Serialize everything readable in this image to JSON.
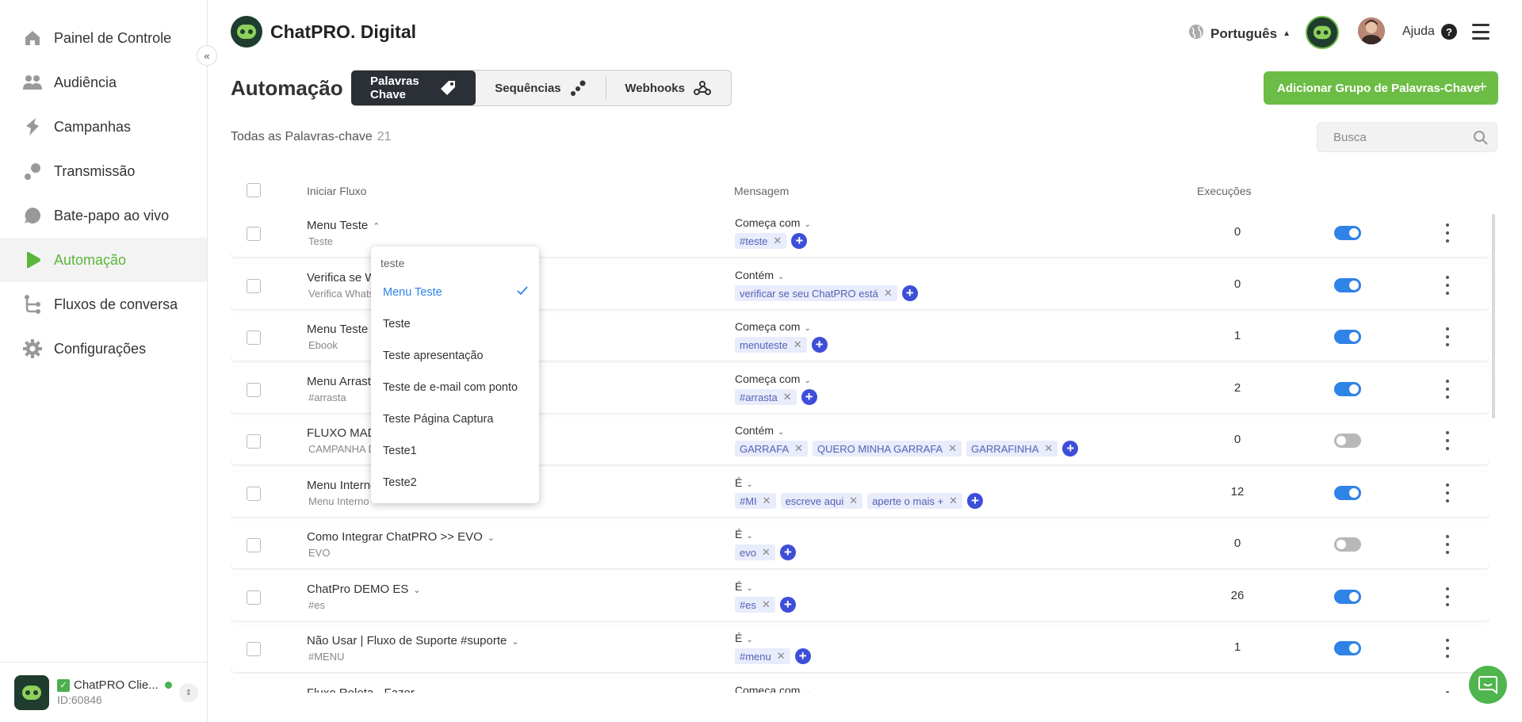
{
  "sidebar": {
    "items": [
      {
        "label": "Painel de Controle",
        "icon": "home-icon"
      },
      {
        "label": "Audiência",
        "icon": "people-icon"
      },
      {
        "label": "Campanhas",
        "icon": "lightning-icon"
      },
      {
        "label": "Transmissão",
        "icon": "broadcast-icon"
      },
      {
        "label": "Bate-papo ao vivo",
        "icon": "chat-bubble-icon"
      },
      {
        "label": "Automação",
        "icon": "play-icon",
        "active": true
      },
      {
        "label": "Fluxos de conversa",
        "icon": "flow-icon"
      },
      {
        "label": "Configurações",
        "icon": "gear-icon"
      }
    ],
    "collapse_icon": "«",
    "account": {
      "name": "ChatPRO Clie...",
      "id": "ID:60846"
    }
  },
  "header": {
    "brand": "ChatPRO. Digital",
    "language": "Português",
    "help": "Ajuda"
  },
  "page": {
    "title": "Automação",
    "tabs": [
      {
        "label": "Palavras Chave",
        "active": true
      },
      {
        "label": "Sequências"
      },
      {
        "label": "Webhooks"
      }
    ],
    "add_button": "Adicionar Grupo de Palavras-Chave",
    "counter_label": "Todas as Palavras-chave",
    "counter_value": "21",
    "search_placeholder": "Busca"
  },
  "table": {
    "headers": {
      "flow": "Iniciar Fluxo",
      "message": "Mensagem",
      "executions": "Execuções"
    },
    "rows": [
      {
        "name": "Menu Teste",
        "sub": "Teste",
        "chevron": "^",
        "condition": "Começa com",
        "tags": [
          "#teste"
        ],
        "executions": "0",
        "enabled": true
      },
      {
        "name": "Verifica se W",
        "sub": "Verifica Whats",
        "chevron": "",
        "condition": "Contém",
        "tags": [
          "verificar se seu ChatPRO está"
        ],
        "executions": "0",
        "enabled": true
      },
      {
        "name": "Menu Teste -",
        "sub": "Ebook",
        "chevron": "",
        "condition": "Começa com",
        "tags": [
          "menuteste"
        ],
        "executions": "1",
        "enabled": true
      },
      {
        "name": "Menu Arrast",
        "sub": "#arrasta",
        "chevron": "",
        "condition": "Começa com",
        "tags": [
          "#arrasta"
        ],
        "executions": "2",
        "enabled": true
      },
      {
        "name": "FLUXO MAD",
        "sub": "CAMPANHA D",
        "chevron": "",
        "condition": "Contém",
        "tags": [
          "GARRAFA",
          "QUERO MINHA GARRAFA",
          "GARRAFINHA"
        ],
        "executions": "0",
        "enabled": false
      },
      {
        "name": "Menu Interno",
        "sub": "Menu Interno",
        "chevron": "",
        "condition": "É",
        "tags": [
          "#MI",
          "escreve aqui",
          "aperte o mais +"
        ],
        "executions": "12",
        "enabled": true
      },
      {
        "name": "Como Integrar ChatPRO >> EVO",
        "sub": "EVO",
        "chevron": "v",
        "condition": "É",
        "tags": [
          "evo"
        ],
        "executions": "0",
        "enabled": false
      },
      {
        "name": "ChatPro DEMO ES",
        "sub": "#es",
        "chevron": "v",
        "condition": "É",
        "tags": [
          "#es"
        ],
        "executions": "26",
        "enabled": true
      },
      {
        "name": "Não Usar | Fluxo de Suporte #suporte",
        "sub": "#MENU",
        "chevron": "v",
        "condition": "É",
        "tags": [
          "#menu"
        ],
        "executions": "1",
        "enabled": true
      },
      {
        "name": "Fluxo Roleta - Fazer",
        "sub": "",
        "chevron": "v",
        "condition": "Começa com",
        "tags": [],
        "executions": "",
        "enabled": true
      }
    ]
  },
  "dropdown": {
    "search_value": "teste",
    "options": [
      "Menu Teste",
      "Teste",
      "Teste apresentação",
      "Teste de e-mail com ponto",
      "Teste Página Captura",
      "Teste1",
      "Teste2"
    ],
    "selected": "Menu Teste"
  },
  "colors": {
    "accent": "#6cbd45",
    "primary": "#2f82e6",
    "tag_add": "#3d4ed8",
    "dark_tab": "#2b2f36"
  }
}
